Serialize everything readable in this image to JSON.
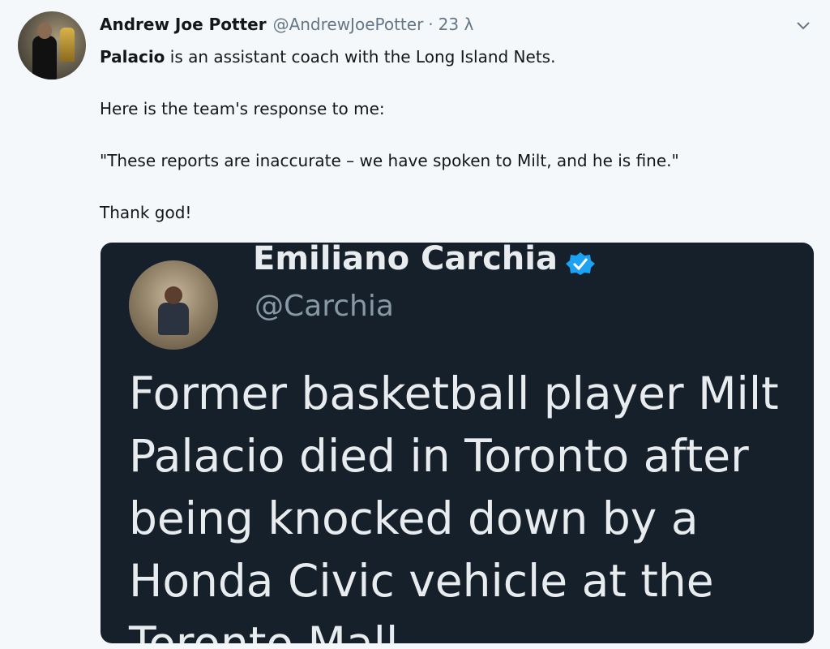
{
  "tweet": {
    "author_name": "Andrew Joe Potter",
    "author_handle": "@AndrewJoePotter",
    "separator": "·",
    "time": "23 λ",
    "line1_bold": "Palacio",
    "line1_rest": " is an assistant coach with the Long Island Nets.",
    "line2": "Here is the team's response to me:",
    "line3": "\"These reports are inaccurate – we have spoken to Milt, and he is fine.\"",
    "line4": "Thank god!"
  },
  "embedded": {
    "name": "Emiliano Carchia",
    "handle": "@Carchia",
    "text": "Former basketball player Milt Palacio died in Toronto after being knocked down by a Honda Civic vehicle at the Toronto Mall"
  },
  "icons": {
    "caret": "chevron-down-icon",
    "verified": "verified-badge-icon"
  },
  "colors": {
    "background": "#f5f8fa",
    "secondary_text": "#657786",
    "media_background": "#15202b",
    "verified_blue": "#1da1f2"
  }
}
